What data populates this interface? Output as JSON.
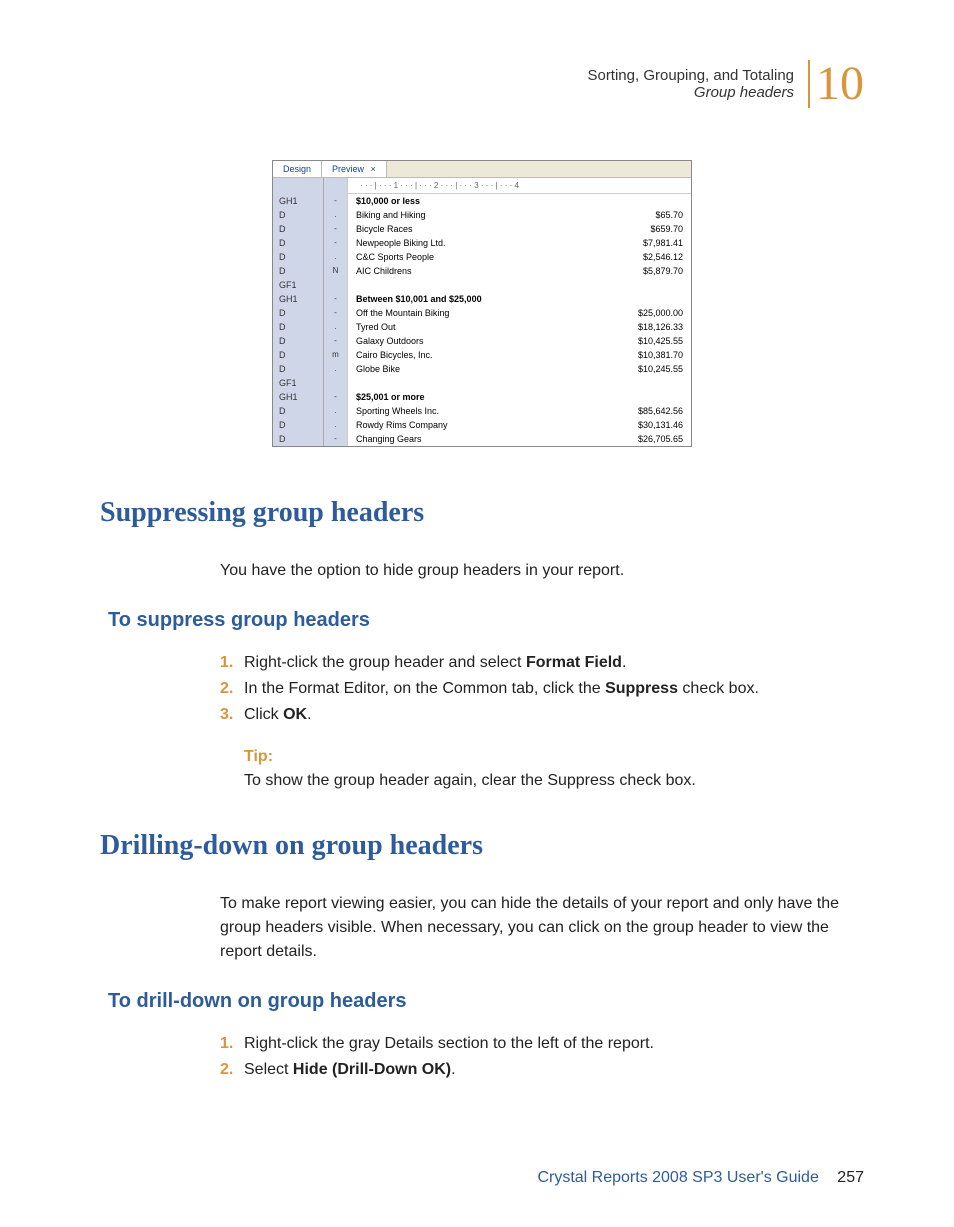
{
  "header": {
    "line1": "Sorting, Grouping, and Totaling",
    "line2": "Group headers",
    "chapter": "10"
  },
  "screenshot": {
    "tabs": [
      "Design",
      "Preview"
    ],
    "close": "×",
    "ruler": "·  ·  ·  |  ·  ·  ·  1  ·  ·  ·  |  ·  ·  ·  2  ·  ·  ·  |  ·  ·  ·  3  ·  ·  ·  |  ·  ·  ·  4",
    "groups": [
      {
        "sec": "GH1",
        "title": "$10,000 or less",
        "rows": [
          {
            "sec": "D",
            "name": "Biking and Hiking",
            "val": "$65.70"
          },
          {
            "sec": "D",
            "name": "Bicycle Races",
            "val": "$659.70"
          },
          {
            "sec": "D",
            "name": "Newpeople Biking Ltd.",
            "val": "$7,981.41"
          },
          {
            "sec": "D",
            "name": "C&C Sports People",
            "val": "$2,546.12"
          },
          {
            "sec": "D",
            "name": "AIC Childrens",
            "val": "$5,879.70"
          }
        ],
        "footer": "GF1"
      },
      {
        "sec": "GH1",
        "title": "Between $10,001 and $25,000",
        "rows": [
          {
            "sec": "D",
            "name": "Off the Mountain Biking",
            "val": "$25,000.00"
          },
          {
            "sec": "D",
            "name": "Tyred Out",
            "val": "$18,126.33"
          },
          {
            "sec": "D",
            "name": "Galaxy Outdoors",
            "val": "$10,425.55"
          },
          {
            "sec": "D",
            "name": "Cairo Bicycles, Inc.",
            "val": "$10,381.70"
          },
          {
            "sec": "D",
            "name": "Globe Bike",
            "val": "$10,245.55"
          }
        ],
        "footer": "GF1"
      },
      {
        "sec": "GH1",
        "title": "$25,001 or more",
        "rows": [
          {
            "sec": "D",
            "name": "Sporting Wheels Inc.",
            "val": "$85,642.56"
          },
          {
            "sec": "D",
            "name": "Rowdy Rims Company",
            "val": "$30,131.46"
          },
          {
            "sec": "D",
            "name": "Changing Gears",
            "val": "$26,705.65"
          }
        ]
      }
    ]
  },
  "section1": {
    "title": "Suppressing group headers",
    "intro": "You have the option to hide group headers in your report.",
    "subtitle": "To suppress group headers",
    "steps": [
      {
        "pre": "Right-click the group header and select ",
        "bold": "Format Field",
        "post": "."
      },
      {
        "pre": "In the Format Editor, on the Common tab, click the ",
        "bold": "Suppress",
        "post": " check box."
      },
      {
        "pre": "Click ",
        "bold": "OK",
        "post": "."
      }
    ],
    "tip_label": "Tip:",
    "tip_text": "To show the group header again, clear the Suppress check box."
  },
  "section2": {
    "title": "Drilling-down on group headers",
    "intro": "To make report viewing easier, you can hide the details of your report and only have the group headers visible. When necessary, you can click on the group header to view the report details.",
    "subtitle": "To drill-down on group headers",
    "steps": [
      {
        "pre": "Right-click the gray Details section to the left of the report.",
        "bold": "",
        "post": ""
      },
      {
        "pre": "Select ",
        "bold": "Hide (Drill-Down OK)",
        "post": "."
      }
    ]
  },
  "footer": {
    "title": "Crystal Reports 2008 SP3 User's Guide",
    "page": "257"
  }
}
